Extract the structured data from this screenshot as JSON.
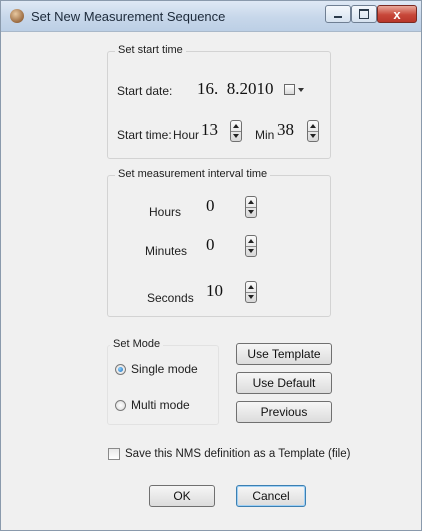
{
  "window": {
    "title": "Set New Measurement Sequence",
    "close_symbol": "x"
  },
  "start_time": {
    "group_label": "Set start time",
    "date_label": "Start date:",
    "date_value": "16.  8.2010",
    "time_label": "Start time:",
    "hour_label": "Hour",
    "hour_value": "13",
    "min_label": "Min",
    "min_value": "38"
  },
  "interval": {
    "group_label": "Set measurement interval time",
    "hours_label": "Hours",
    "hours_value": "0",
    "minutes_label": "Minutes",
    "minutes_value": "0",
    "seconds_label": "Seconds",
    "seconds_value": "10"
  },
  "mode": {
    "group_label": "Set Mode",
    "single_label": "Single mode",
    "multi_label": "Multi mode",
    "selected": "single"
  },
  "side_buttons": {
    "use_template": "Use Template",
    "use_default": "Use Default",
    "previous": "Previous"
  },
  "save_template": {
    "label": "Save this NMS definition as a Template (file)",
    "checked": false
  },
  "footer": {
    "ok": "OK",
    "cancel": "Cancel"
  },
  "icons": [
    "app-icon",
    "minimize-icon",
    "maximize-icon",
    "close-icon",
    "calendar-icon",
    "dropdown-arrow-icon",
    "spin-icon"
  ]
}
